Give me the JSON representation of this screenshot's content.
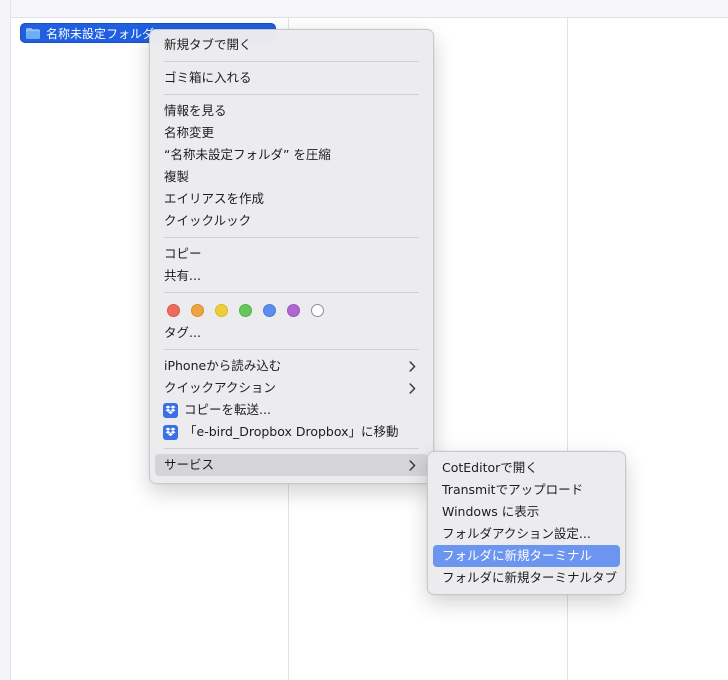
{
  "folder": {
    "name": "名称未設定フォルダ"
  },
  "context_menu": {
    "open_new_tab": "新規タブで開く",
    "move_to_trash": "ゴミ箱に入れる",
    "get_info": "情報を見る",
    "rename": "名称変更",
    "compress": "“名称未設定フォルダ” を圧縮",
    "duplicate": "複製",
    "make_alias": "エイリアスを作成",
    "quick_look": "クイックルック",
    "copy": "コピー",
    "share": "共有...",
    "tags_label": "タグ...",
    "tag_colors": [
      "#ec6a5e",
      "#eba43e",
      "#f0cd3a",
      "#68c55e",
      "#5b8ef0",
      "#b067d4",
      "#ffffff"
    ],
    "import_from_iphone": "iPhoneから読み込む",
    "quick_actions": "クイックアクション",
    "send_copy": "コピーを転送...",
    "move_to_dropbox": "「e-bird_Dropbox Dropbox」に移動",
    "services": "サービス"
  },
  "services_menu": {
    "items": [
      "CotEditorで開く",
      "Transmitでアップロード",
      "Windows に表示",
      "フォルダアクション設定...",
      "フォルダに新規ターミナル",
      "フォルダに新規ターミナルタブ"
    ],
    "selected_index": 4
  },
  "colors": {
    "selection": "#1f5fe0",
    "highlight": "#6c95ef",
    "dropbox": "#3a6fe8"
  }
}
